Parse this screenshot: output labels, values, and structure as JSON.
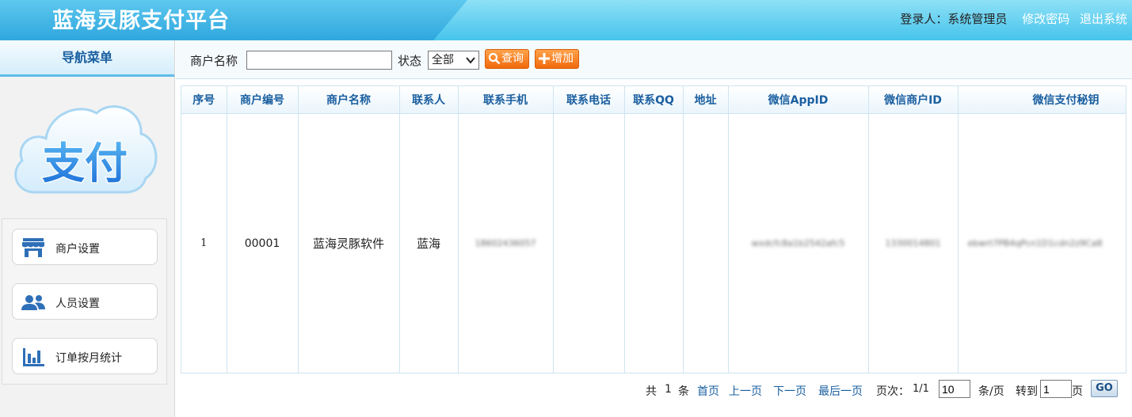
{
  "header": {
    "app_title": "蓝海灵豚支付平台",
    "login_label": "登录人：系统管理员",
    "change_password": "修改密码",
    "logout": "退出系统"
  },
  "sidebar": {
    "nav_title": "导航菜单",
    "logo_text": "支付",
    "items": [
      {
        "label": "商户设置",
        "icon": "storefront-icon"
      },
      {
        "label": "人员设置",
        "icon": "users-icon"
      },
      {
        "label": "订单按月统计",
        "icon": "bar-chart-icon"
      }
    ]
  },
  "toolbar": {
    "merchant_name_label": "商户名称",
    "merchant_name_value": "",
    "status_label": "状态",
    "status_value": "全部",
    "search_label": "查询",
    "add_label": "增加"
  },
  "table": {
    "columns": [
      "序号",
      "商户编号",
      "商户名称",
      "联系人",
      "联系手机",
      "联系电话",
      "联系QQ",
      "地址",
      "微信AppID",
      "微信商户ID",
      "微信支付秘钥"
    ],
    "rows": [
      [
        "1",
        "00001",
        "蓝海灵豚软件",
        "蓝海",
        "18602436057",
        "",
        "",
        "",
        "wxdcfc8a1b2542afc5",
        "1330014801",
        "ebwrt7PB4qPcn1D1cdn2z9Ca8"
      ]
    ]
  },
  "pager": {
    "total_prefix": "共",
    "total": "1",
    "total_suffix": "条",
    "first": "首页",
    "prev": "上一页",
    "next": "下一页",
    "last": "最后一页",
    "page_label": "页次：",
    "page_info": "1/1",
    "page_size": "10",
    "per_page_label": "条/页",
    "goto_label": "转到",
    "goto_value": "1",
    "page_unit": "页",
    "go_label": "GO"
  },
  "colors": {
    "header_blue": "#2ea7de",
    "link_blue": "#1a5fa0",
    "button_orange": "#f06a0c"
  }
}
